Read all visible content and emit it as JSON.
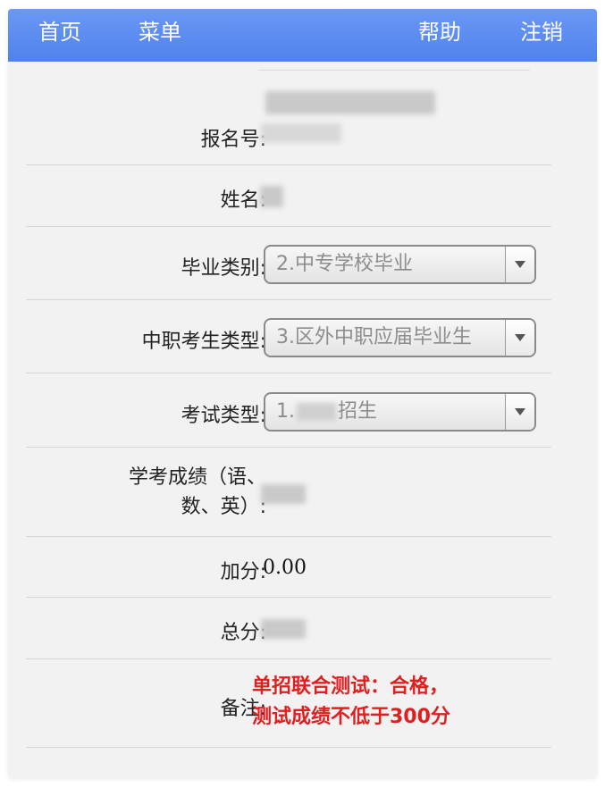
{
  "nav": {
    "home": "首页",
    "menu": "菜单",
    "help": "帮助",
    "logout": "注销"
  },
  "form": {
    "registration_no_label": "报名号:",
    "name_label": "姓名:",
    "graduation_type_label": "毕业类别:",
    "graduation_type_value": "2.中专学校毕业",
    "vocational_type_label": "中职考生类型:",
    "vocational_type_value": "3.区外中职应届毕业生",
    "exam_type_label": "考试类型:",
    "exam_type_prefix": "1.",
    "exam_type_suffix": "招生",
    "academic_score_label_line1": "学考成绩（语、",
    "academic_score_label_line2": "数、英）:",
    "bonus_label": "加分:",
    "bonus_value": "0.00",
    "total_label": "总分:",
    "remark_label": "备注:",
    "remark_line1": "单招联合测试：合格，",
    "remark_line2": "测试成绩不低于300分"
  },
  "colors": {
    "nav_bg": "#5b8cf0",
    "remark_text": "#e02020",
    "page_bg": "#f2f2f2"
  }
}
